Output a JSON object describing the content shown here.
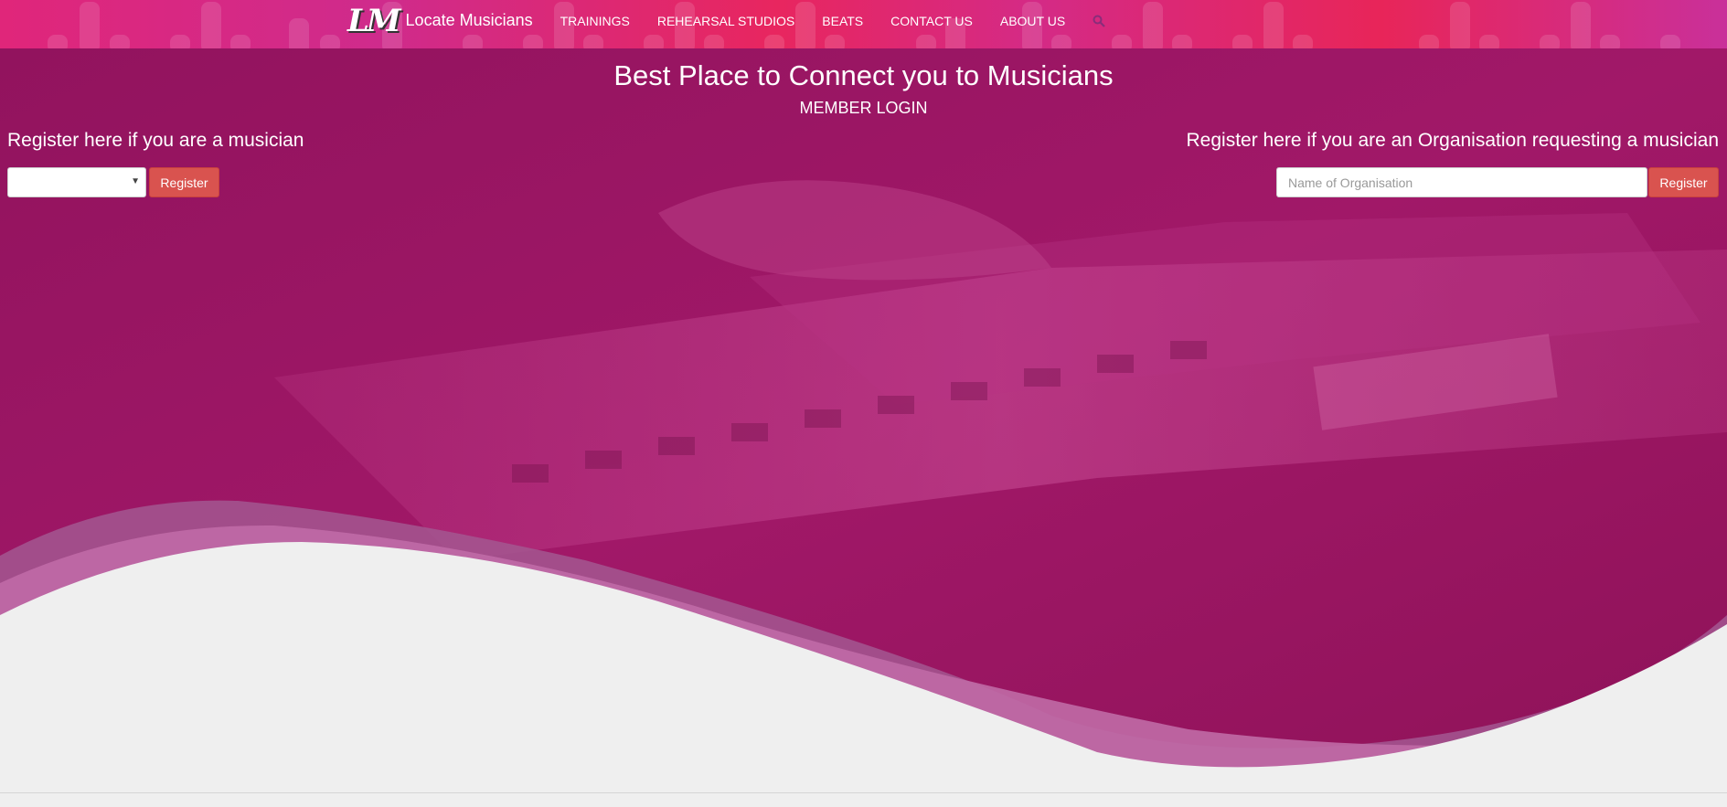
{
  "nav": {
    "logo_text": "LM",
    "brand": "Locate Musicians",
    "links": [
      "TRAININGS",
      "REHEARSAL STUDIOS",
      "BEATS",
      "CONTACT US",
      "ABOUT US"
    ]
  },
  "hero": {
    "headline": "Best Place to Connect you to Musicians",
    "member_login": "MEMBER LOGIN",
    "musician": {
      "title": "Register here if you are a musician",
      "select_value": "",
      "button": "Register"
    },
    "organisation": {
      "title": "Register here if you are an Organisation requesting a musician",
      "placeholder": "Name of Organisation",
      "button": "Register"
    }
  },
  "colors": {
    "nav_pink": "#e0267a",
    "hero_magenta": "#9a1660",
    "register_button": "#d9534f",
    "background_gray": "#efefef"
  },
  "icons": [
    "search-icon",
    "select-caret-icon"
  ]
}
